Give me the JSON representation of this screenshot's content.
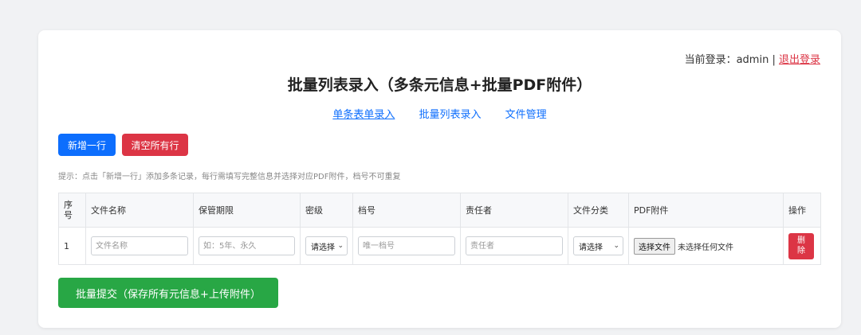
{
  "header": {
    "login_label": "当前登录：admin | ",
    "logout_label": "退出登录",
    "title": "批量列表录入（多条元信息+批量PDF附件）"
  },
  "nav": {
    "single": "单条表单录入",
    "batch": "批量列表录入",
    "files": "文件管理"
  },
  "toolbar": {
    "add_row": "新增一行",
    "clear_rows": "清空所有行",
    "hint": "提示：点击「新增一行」添加多条记录，每行需填写完整信息并选择对应PDF附件，档号不可重复"
  },
  "table": {
    "headers": [
      "序号",
      "文件名称",
      "保管期限",
      "密级",
      "档号",
      "责任者",
      "文件分类",
      "PDF附件",
      "操作"
    ],
    "row": {
      "index": "1",
      "name_placeholder": "文件名称",
      "period_placeholder": "如：5年、永久",
      "secret_select": "请选择",
      "archive_placeholder": "唯一档号",
      "owner_placeholder": "责任者",
      "category_select": "请选择",
      "file_button": "选择文件",
      "file_status": "未选择任何文件",
      "delete": "删除"
    }
  },
  "submit_label": "批量提交（保存所有元信息+上传附件）"
}
